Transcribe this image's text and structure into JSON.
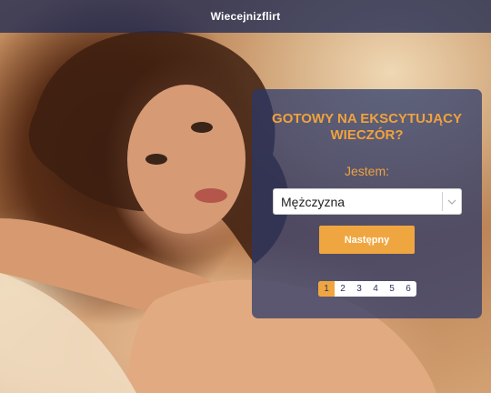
{
  "header": {
    "brand": "Wiecejnizflirt",
    "background": "#202c54"
  },
  "form": {
    "headline_line1": "GOTOWY NA EKSCYTUJĄCY",
    "headline_line2": "WIECZÓR?",
    "gender_label": "Jestem:",
    "gender_value": "Mężczyzna",
    "next_label": "Następny",
    "accent_color": "#f0a640"
  },
  "pagination": {
    "pages": [
      "1",
      "2",
      "3",
      "4",
      "5",
      "6"
    ],
    "active": "1"
  },
  "icons": {
    "select_arrow": "chevron-down-icon"
  }
}
